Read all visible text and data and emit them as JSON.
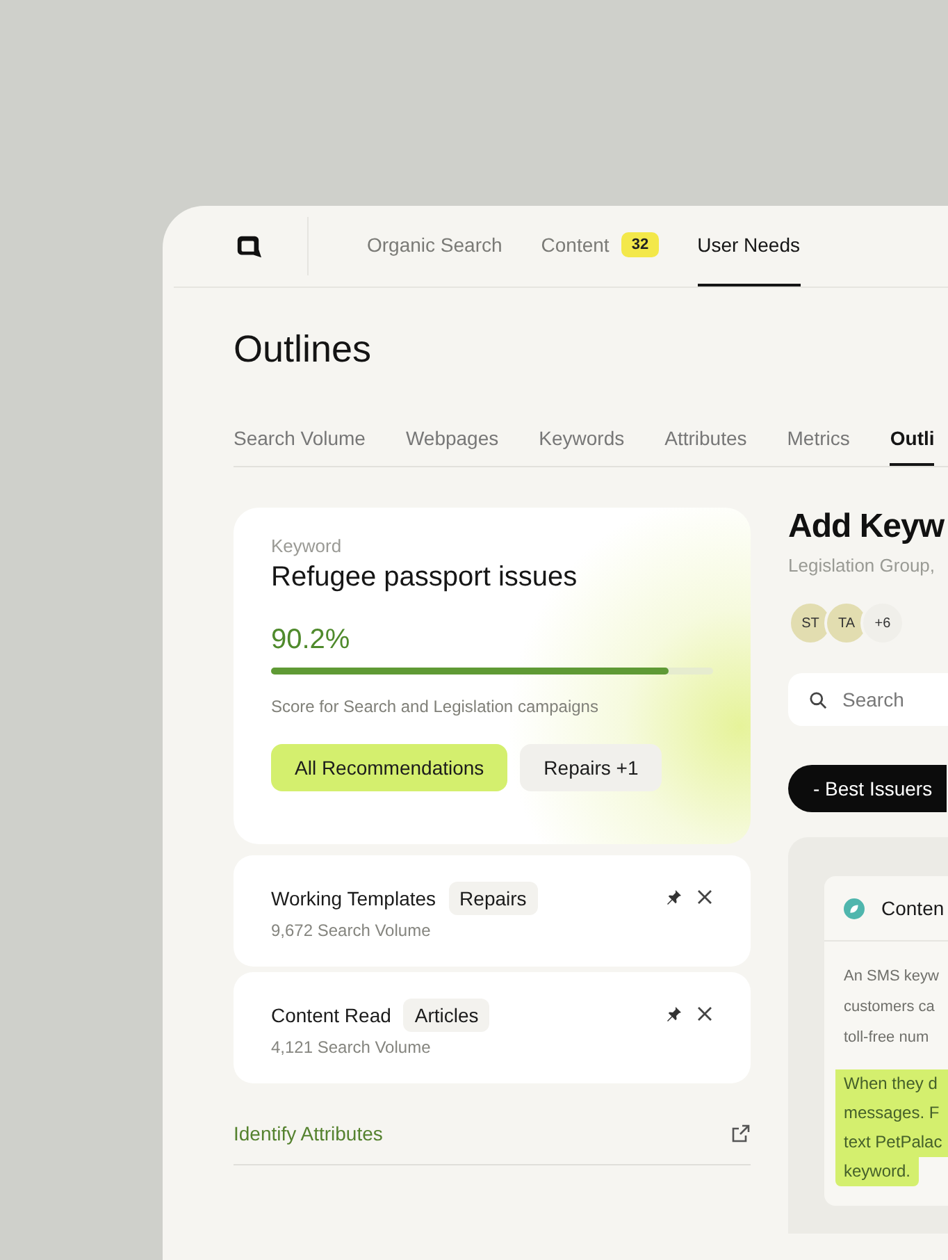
{
  "nav": {
    "items": [
      {
        "label": "Organic Search",
        "selected": false
      },
      {
        "label": "Content",
        "badge": "32",
        "selected": false
      },
      {
        "label": "User Needs",
        "selected": true
      }
    ]
  },
  "title": "Outlines",
  "tabs": [
    {
      "label": "Search Volume",
      "selected": false
    },
    {
      "label": "Webpages",
      "selected": false
    },
    {
      "label": "Keywords",
      "selected": false
    },
    {
      "label": "Attributes",
      "selected": false
    },
    {
      "label": "Metrics",
      "selected": false
    },
    {
      "label": "Outli",
      "selected": true
    }
  ],
  "keyword_card": {
    "label": "Keyword",
    "keyword": "Refugee passport issues",
    "score": "90.2%",
    "level": 0.9,
    "caption": "Score for Search and Legislation campaigns",
    "buttons": [
      {
        "label": "All Recommendations",
        "selected": true
      },
      {
        "label": "Repairs +1",
        "selected": false
      }
    ]
  },
  "saved": [
    {
      "name": "Working Templates",
      "tag": "Repairs",
      "volume": "9,672 Search Volume"
    },
    {
      "name": "Content Read",
      "tag": "Articles",
      "volume": "4,121 Search Volume"
    }
  ],
  "link": "Identify Attributes",
  "side": {
    "title": "Add Keyw",
    "subtitle": "Legislation Group,",
    "avatars": [
      "ST",
      "TA"
    ],
    "more": "+6",
    "search": {
      "placeholder": "Search"
    },
    "filter": "- Best Issuers",
    "content": {
      "title": "Conten",
      "lines": [
        "An SMS keyw",
        "customers ca",
        "toll-free num"
      ],
      "highlight_lines": [
        "When they d",
        "messages. F",
        "text PetPalac",
        "keyword."
      ]
    }
  }
}
